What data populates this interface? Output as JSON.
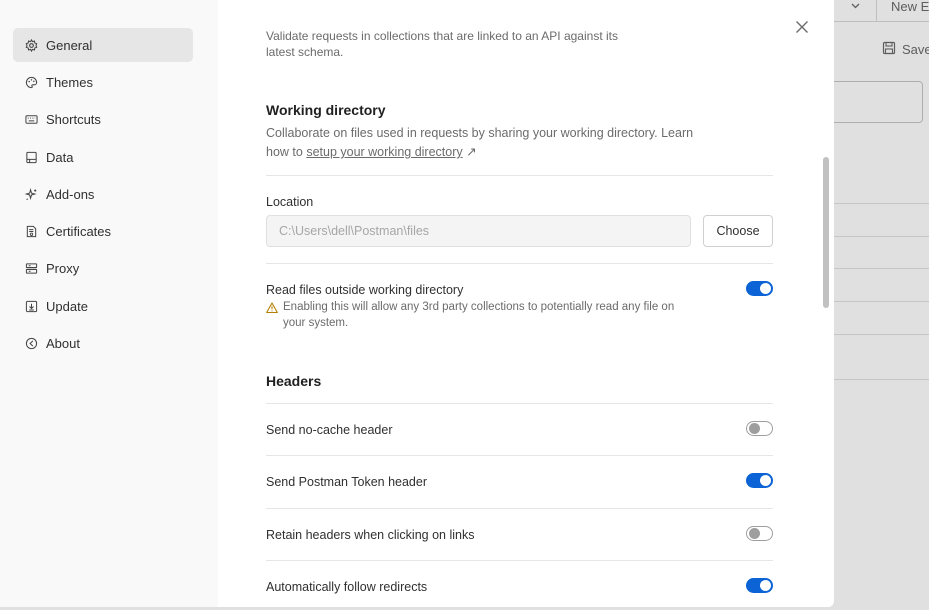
{
  "background": {
    "new_tab_label": "New E",
    "save_label": "Save"
  },
  "sidebar": {
    "items": [
      {
        "label": "General",
        "icon": "gear-icon",
        "active": true
      },
      {
        "label": "Themes",
        "icon": "palette-icon"
      },
      {
        "label": "Shortcuts",
        "icon": "keyboard-icon"
      },
      {
        "label": "Data",
        "icon": "data-icon"
      },
      {
        "label": "Add-ons",
        "icon": "sparkle-icon"
      },
      {
        "label": "Certificates",
        "icon": "certificate-icon"
      },
      {
        "label": "Proxy",
        "icon": "proxy-icon"
      },
      {
        "label": "Update",
        "icon": "download-icon"
      },
      {
        "label": "About",
        "icon": "about-icon"
      }
    ]
  },
  "content": {
    "top_description_line1": "Validate requests in collections that are linked to an API against its",
    "top_description_line2": "latest schema.",
    "working_directory": {
      "title": "Working directory",
      "description_line1": "Collaborate on files used in requests by sharing your working directory. Learn",
      "description_prefix": "how to ",
      "link_text": "setup your working directory",
      "link_arrow": "↗",
      "location_label": "Location",
      "location_value": "C:\\Users\\dell\\Postman\\files",
      "choose_label": "Choose",
      "read_outside_label": "Read files outside working directory",
      "read_outside_on": true,
      "warning_line1": "Enabling this will allow any 3rd party collections to potentially read any file on",
      "warning_line2": "your system."
    },
    "headers": {
      "title": "Headers",
      "items": [
        {
          "label": "Send no-cache header",
          "on": false
        },
        {
          "label": "Send Postman Token header",
          "on": true
        },
        {
          "label": "Retain headers when clicking on links",
          "on": false
        },
        {
          "label": "Automatically follow redirects",
          "on": true
        }
      ]
    }
  },
  "colors": {
    "accent": "#0b63d6",
    "sidebar_bg": "#f9f9f9",
    "active_item_bg": "#e6e6e6",
    "warning": "#b47d00"
  }
}
